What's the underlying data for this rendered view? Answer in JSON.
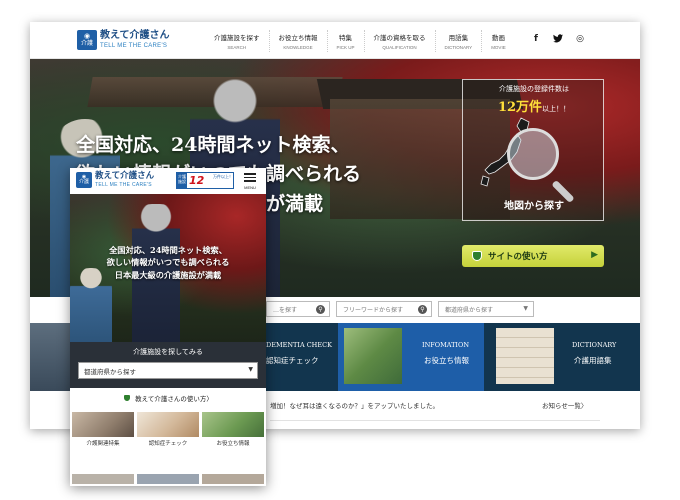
{
  "desktop": {
    "logo": {
      "mark_glyph": "介護",
      "title": "教えて介護さん",
      "tagline": "TELL ME THE CARE'S"
    },
    "nav": [
      {
        "jp": "介護施設を探す",
        "en": "SEARCH"
      },
      {
        "jp": "お役立ち情報",
        "en": "KNOWLEDGE"
      },
      {
        "jp": "特集",
        "en": "PICK UP"
      },
      {
        "jp": "介護の資格を取る",
        "en": "QUALIFICATION"
      },
      {
        "jp": "用語集",
        "en": "DICTIONARY"
      },
      {
        "jp": "動画",
        "en": "MOVIE"
      }
    ],
    "social": [
      {
        "icon": "facebook-icon",
        "glyph": "f"
      },
      {
        "icon": "twitter-icon",
        "glyph": "🐦"
      },
      {
        "icon": "instagram-icon",
        "glyph": "◎"
      }
    ],
    "hero": {
      "line1": "全国対応、24時間ネット検索、",
      "line2": "欲しい情報がいつでも調べられる",
      "line3": "日本最大級の介護施設が満載",
      "map_head1": "介護施設の登録件数は",
      "map_count": "12万件",
      "map_suffix": "以上！！",
      "map_label": "地図から探す",
      "guide_label": "サイトの使い方",
      "guide_arrow": "▶"
    },
    "search": {
      "keyword_placeholder": "…を探す",
      "freeword_placeholder": "フリーワードから探す",
      "pref_placeholder": "都道府県から探す"
    },
    "features": [
      {
        "en": "DEMENTIA CHECK",
        "jp": "認知症チェック"
      },
      {
        "en": "INFOMATION",
        "jp": "お役立ち情報"
      },
      {
        "en": "DICTIONARY",
        "jp": "介護用語集"
      }
    ],
    "news": {
      "text": "増加！なぜ耳は遠くなるのか？」をアップいたしました。",
      "more": "お知らせ一覧〉"
    },
    "colors": {
      "brand_blue": "#1f5fa6",
      "accent_red": "#d0121b",
      "guide_green": "#c5d13a",
      "dark_panel": "#12354e"
    }
  },
  "mobile": {
    "logo": {
      "mark_glyph": "介護",
      "title": "教えて介護さん",
      "tagline": "TELL ME THE CARE'S"
    },
    "badge": {
      "left": "介護施設",
      "number": "12",
      "right": "万件以上！"
    },
    "menu_label": "MENU",
    "hero": {
      "line1": "全国対応、24時間ネット検索、",
      "line2": "欲しい情報がいつでも調べられる",
      "line3": "日本最大級の介護施設が満載"
    },
    "search_title": "介護施設を探してみる",
    "select_value": "都道府県から探す",
    "select_caret": "▼",
    "guide_label": "教えて介護さんの使い方〉",
    "cards": [
      {
        "label": "介護関連特集"
      },
      {
        "label": "認知症チェック"
      },
      {
        "label": "お役立ち情報"
      }
    ]
  }
}
